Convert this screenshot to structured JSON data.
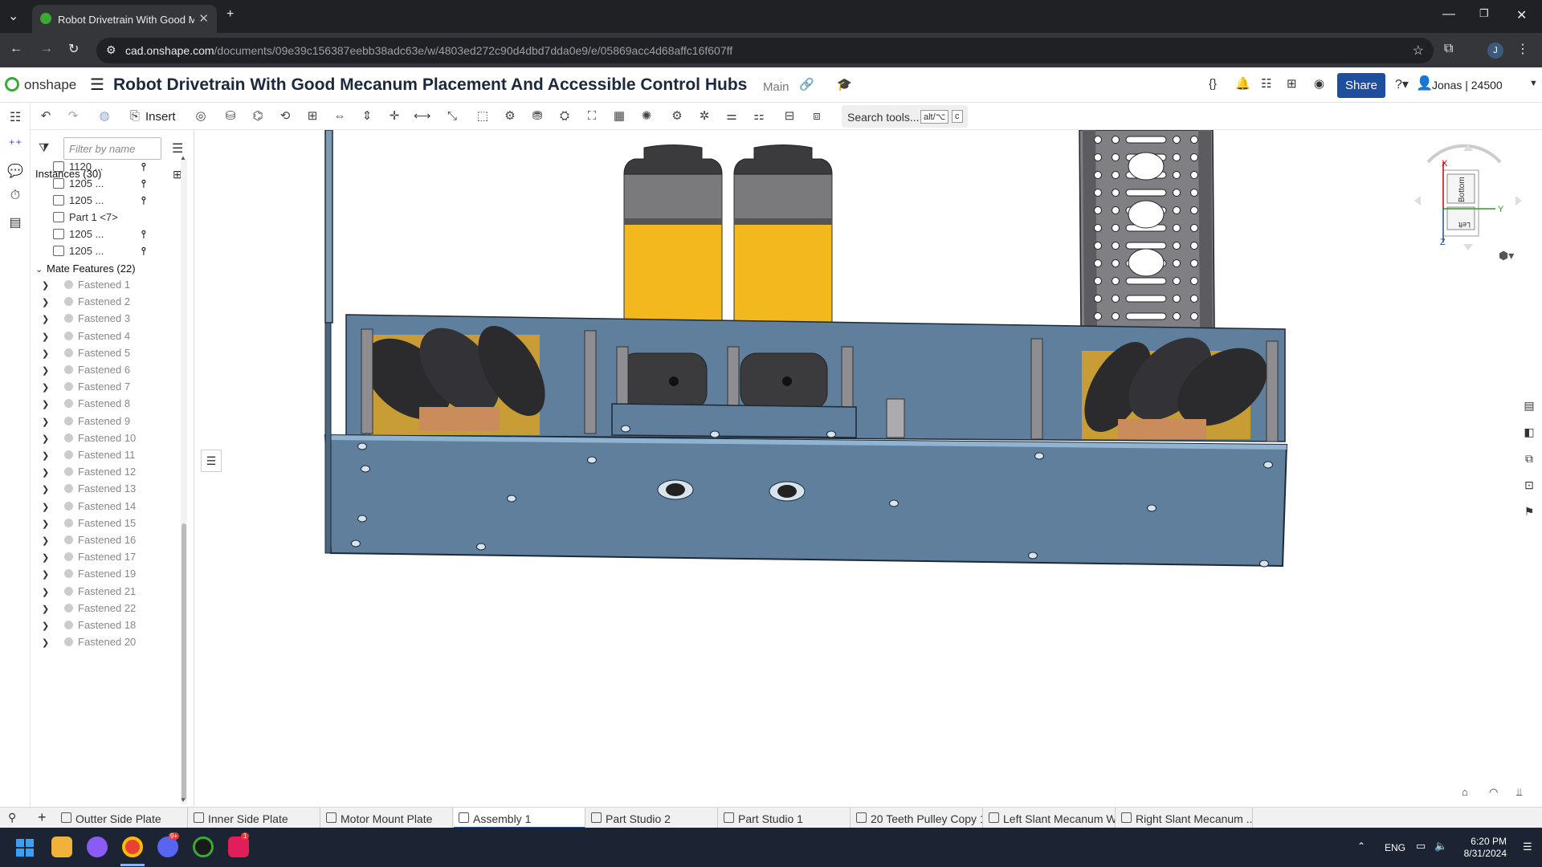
{
  "browser": {
    "tab_title": "Robot Drivetrain With Good Me",
    "url_host": "cad.onshape.com",
    "url_path": "/documents/09e39c156387eebb38adc63e/w/4803ed272c90d4dbd7dda0e9/e/05869acc4d68affc16f607ff",
    "profile_initial": "J"
  },
  "header": {
    "logo": "onshape",
    "doc_title": "Robot Drivetrain With Good Mecanum Placement And Accessible Control Hubs",
    "branch": "Main",
    "share_label": "Share",
    "user_label": "Jonas | 24500"
  },
  "toolbar": {
    "insert_label": "Insert",
    "search_label": "Search tools...",
    "search_key1": "alt/⌥",
    "search_key2": "c"
  },
  "panel": {
    "filter_placeholder": "Filter by name",
    "instances_header": "Instances (30)",
    "instances": [
      {
        "label": "1120 ...",
        "mate": true
      },
      {
        "label": "1205 ...",
        "mate": true
      },
      {
        "label": "1205 ...",
        "mate": true
      },
      {
        "label": "Part 1 <7>",
        "mate": false
      },
      {
        "label": "1205 ...",
        "mate": true
      },
      {
        "label": "1205 ...",
        "mate": true
      }
    ],
    "mates_header": "Mate Features (22)",
    "mates": [
      "Fastened 1",
      "Fastened 2",
      "Fastened 3",
      "Fastened 4",
      "Fastened 5",
      "Fastened 6",
      "Fastened 7",
      "Fastened 8",
      "Fastened 9",
      "Fastened 10",
      "Fastened 11",
      "Fastened 12",
      "Fastened 13",
      "Fastened 14",
      "Fastened 15",
      "Fastened 16",
      "Fastened 17",
      "Fastened 19",
      "Fastened 21",
      "Fastened 22",
      "Fastened 18",
      "Fastened 20"
    ]
  },
  "viewcube": {
    "axis_x": "X",
    "axis_y": "Y",
    "axis_z": "Z",
    "face_bottom": "Bottom",
    "face_left": "Left"
  },
  "bottom_tabs": [
    {
      "label": "Outter Side Plate",
      "active": false
    },
    {
      "label": "Inner Side Plate",
      "active": false
    },
    {
      "label": "Motor Mount Plate",
      "active": false
    },
    {
      "label": "Assembly 1",
      "active": true
    },
    {
      "label": "Part Studio 2",
      "active": false
    },
    {
      "label": "Part Studio 1",
      "active": false
    },
    {
      "label": "20 Teeth Pulley Copy 1",
      "active": false
    },
    {
      "label": "Left Slant Mecanum W...",
      "active": false
    },
    {
      "label": "Right Slant Mecanum ...",
      "active": false
    }
  ],
  "taskbar": {
    "lang": "ENG",
    "time": "6:20 PM",
    "date": "8/31/2024",
    "discord_badge": "9+",
    "slack_badge": "1"
  },
  "colors": {
    "plate": "#5f7f9c",
    "plate_edge": "#1c2a36",
    "motor_yellow": "#f2b81d",
    "share_blue": "#1f4e9c"
  }
}
